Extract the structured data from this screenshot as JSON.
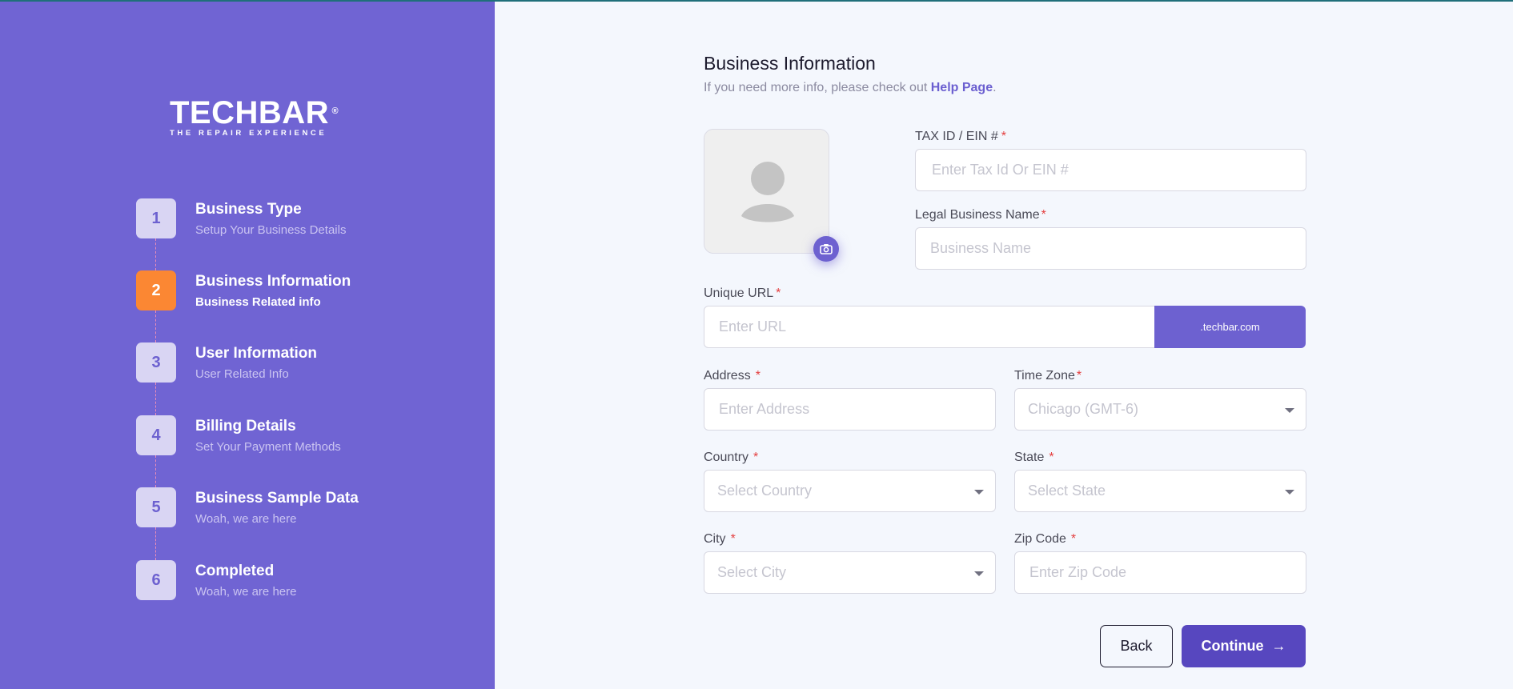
{
  "brand": {
    "name": "TECHBAR",
    "registered": "®",
    "tagline": "THE REPAIR EXPERIENCE"
  },
  "steps": [
    {
      "number": "1",
      "title": "Business Type",
      "subtitle": "Setup Your Business Details",
      "active": false
    },
    {
      "number": "2",
      "title": "Business Information",
      "subtitle": "Business Related info",
      "active": true
    },
    {
      "number": "3",
      "title": "User Information",
      "subtitle": "User Related Info",
      "active": false
    },
    {
      "number": "4",
      "title": "Billing Details",
      "subtitle": "Set Your Payment Methods",
      "active": false
    },
    {
      "number": "5",
      "title": "Business Sample Data",
      "subtitle": "Woah, we are here",
      "active": false
    },
    {
      "number": "6",
      "title": "Completed",
      "subtitle": "Woah, we are here",
      "active": false
    }
  ],
  "form": {
    "title": "Business Information",
    "subtitle_prefix": "If you need more info, please check out ",
    "help_link": "Help Page",
    "subtitle_suffix": ".",
    "required_mark": "*",
    "fields": {
      "tax_id": {
        "label": "TAX ID / EIN #",
        "placeholder": "Enter Tax Id Or EIN #"
      },
      "legal_name": {
        "label": "Legal Business Name",
        "placeholder": "Business Name"
      },
      "unique_url": {
        "label": "Unique URL",
        "placeholder": "Enter URL",
        "suffix": ".techbar.com"
      },
      "address": {
        "label": "Address",
        "placeholder": "Enter Address"
      },
      "time_zone": {
        "label": "Time Zone",
        "value": "Chicago (GMT-6)"
      },
      "country": {
        "label": "Country",
        "placeholder": "Select Country"
      },
      "state": {
        "label": "State",
        "placeholder": "Select State"
      },
      "city": {
        "label": "City",
        "placeholder": "Select City"
      },
      "zip": {
        "label": "Zip Code",
        "placeholder": "Enter Zip Code"
      }
    },
    "back_label": "Back",
    "continue_label": "Continue",
    "continue_icon": "→"
  },
  "colors": {
    "sidebar": "#7064d3",
    "active_step": "#fb8733",
    "accent": "#6d61d0",
    "primary_button": "#5747bf",
    "required": "#e43f3f"
  },
  "icons": {
    "avatar": "user-placeholder-icon",
    "camera": "camera-icon",
    "dropdown": "chevron-down-icon",
    "arrow": "arrow-right-icon"
  }
}
